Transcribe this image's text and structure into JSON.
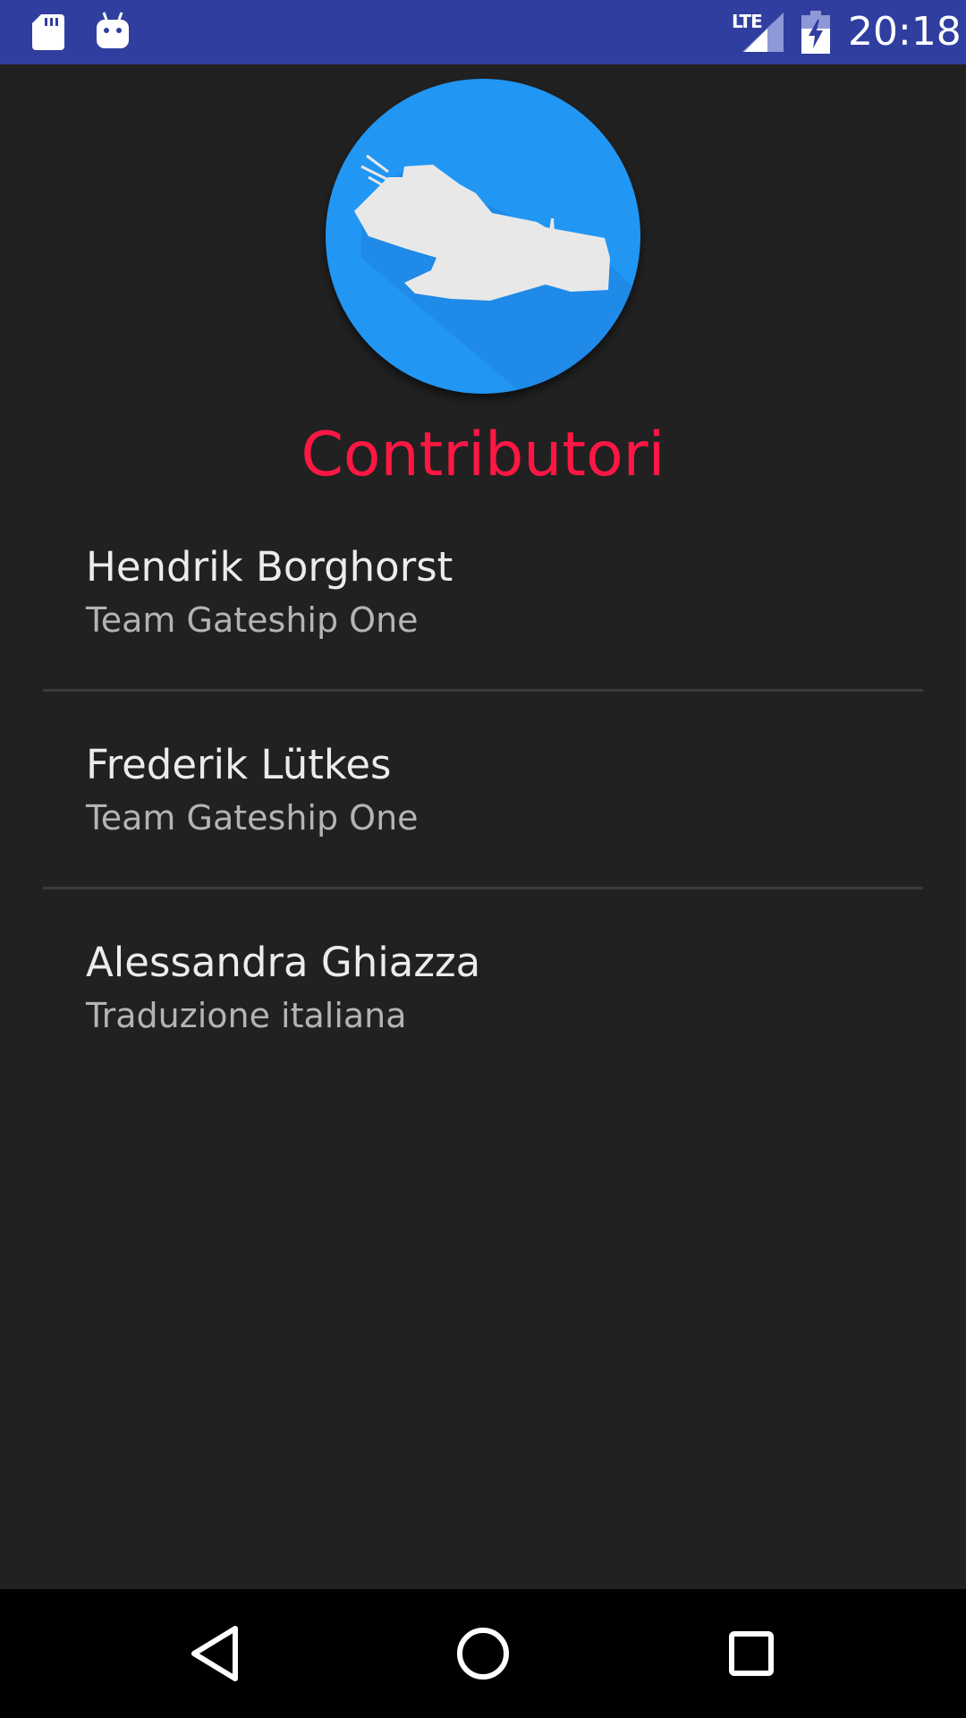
{
  "status_bar": {
    "network_label": "LTE",
    "time": "20:18",
    "background_color": "#303f9f",
    "icons": [
      "sd-card-icon",
      "android-debug-icon",
      "signal-icon",
      "battery-charging-icon"
    ]
  },
  "header": {
    "logo_icon": "spaceship-icon",
    "logo_color": "#2196f3",
    "title": "Contributori",
    "title_color": "#ff1744"
  },
  "contributors": [
    {
      "name": "Hendrik Borghorst",
      "role": "Team Gateship One"
    },
    {
      "name": "Frederik Lütkes",
      "role": "Team Gateship One"
    },
    {
      "name": "Alessandra Ghiazza",
      "role": "Traduzione italiana"
    }
  ],
  "nav_bar": {
    "buttons": [
      "back-icon",
      "home-icon",
      "recents-icon"
    ]
  }
}
